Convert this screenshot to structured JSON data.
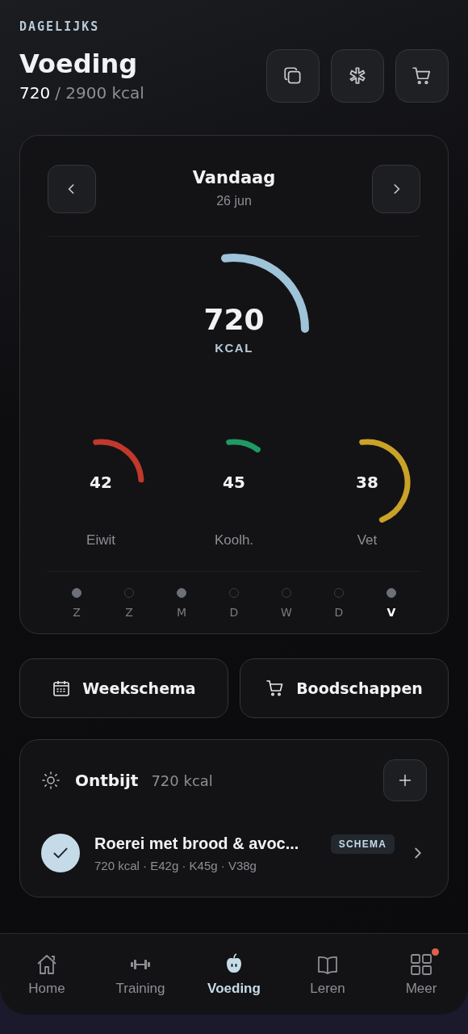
{
  "header": {
    "eyebrow": "DAGELIJKS",
    "title": "Voeding",
    "consumed": "720",
    "target": "/ 2900 kcal"
  },
  "day_card": {
    "title": "Vandaag",
    "date": "26 jun",
    "main": {
      "value": "720",
      "unit": "KCAL"
    },
    "macros": [
      {
        "value": "42",
        "label": "Eiwit",
        "color": "#c0392b"
      },
      {
        "value": "45",
        "label": "Koolh.",
        "color": "#1f9a63"
      },
      {
        "value": "38",
        "label": "Vet",
        "color": "#c9a227"
      }
    ],
    "days": [
      {
        "label": "Z",
        "logged": true,
        "selected": false
      },
      {
        "label": "Z",
        "logged": false,
        "selected": false
      },
      {
        "label": "M",
        "logged": true,
        "selected": false
      },
      {
        "label": "D",
        "logged": false,
        "selected": false
      },
      {
        "label": "W",
        "logged": false,
        "selected": false
      },
      {
        "label": "D",
        "logged": false,
        "selected": false
      },
      {
        "label": "V",
        "logged": true,
        "selected": true
      }
    ]
  },
  "shortcuts": [
    {
      "label": "Weekschema"
    },
    {
      "label": "Boodschappen"
    }
  ],
  "meal": {
    "title": "Ontbijt",
    "kcal": "720 kcal",
    "items": [
      {
        "name": "Roerei met brood & avoc...",
        "badge": "SCHEMA",
        "details": "720 kcal · E42g · K45g · V38g",
        "checked": true
      }
    ]
  },
  "nav": [
    {
      "label": "Home",
      "selected": false,
      "badge": false
    },
    {
      "label": "Training",
      "selected": false,
      "badge": false
    },
    {
      "label": "Voeding",
      "selected": true,
      "badge": false
    },
    {
      "label": "Leren",
      "selected": false,
      "badge": false
    },
    {
      "label": "Meer",
      "selected": false,
      "badge": true
    }
  ]
}
